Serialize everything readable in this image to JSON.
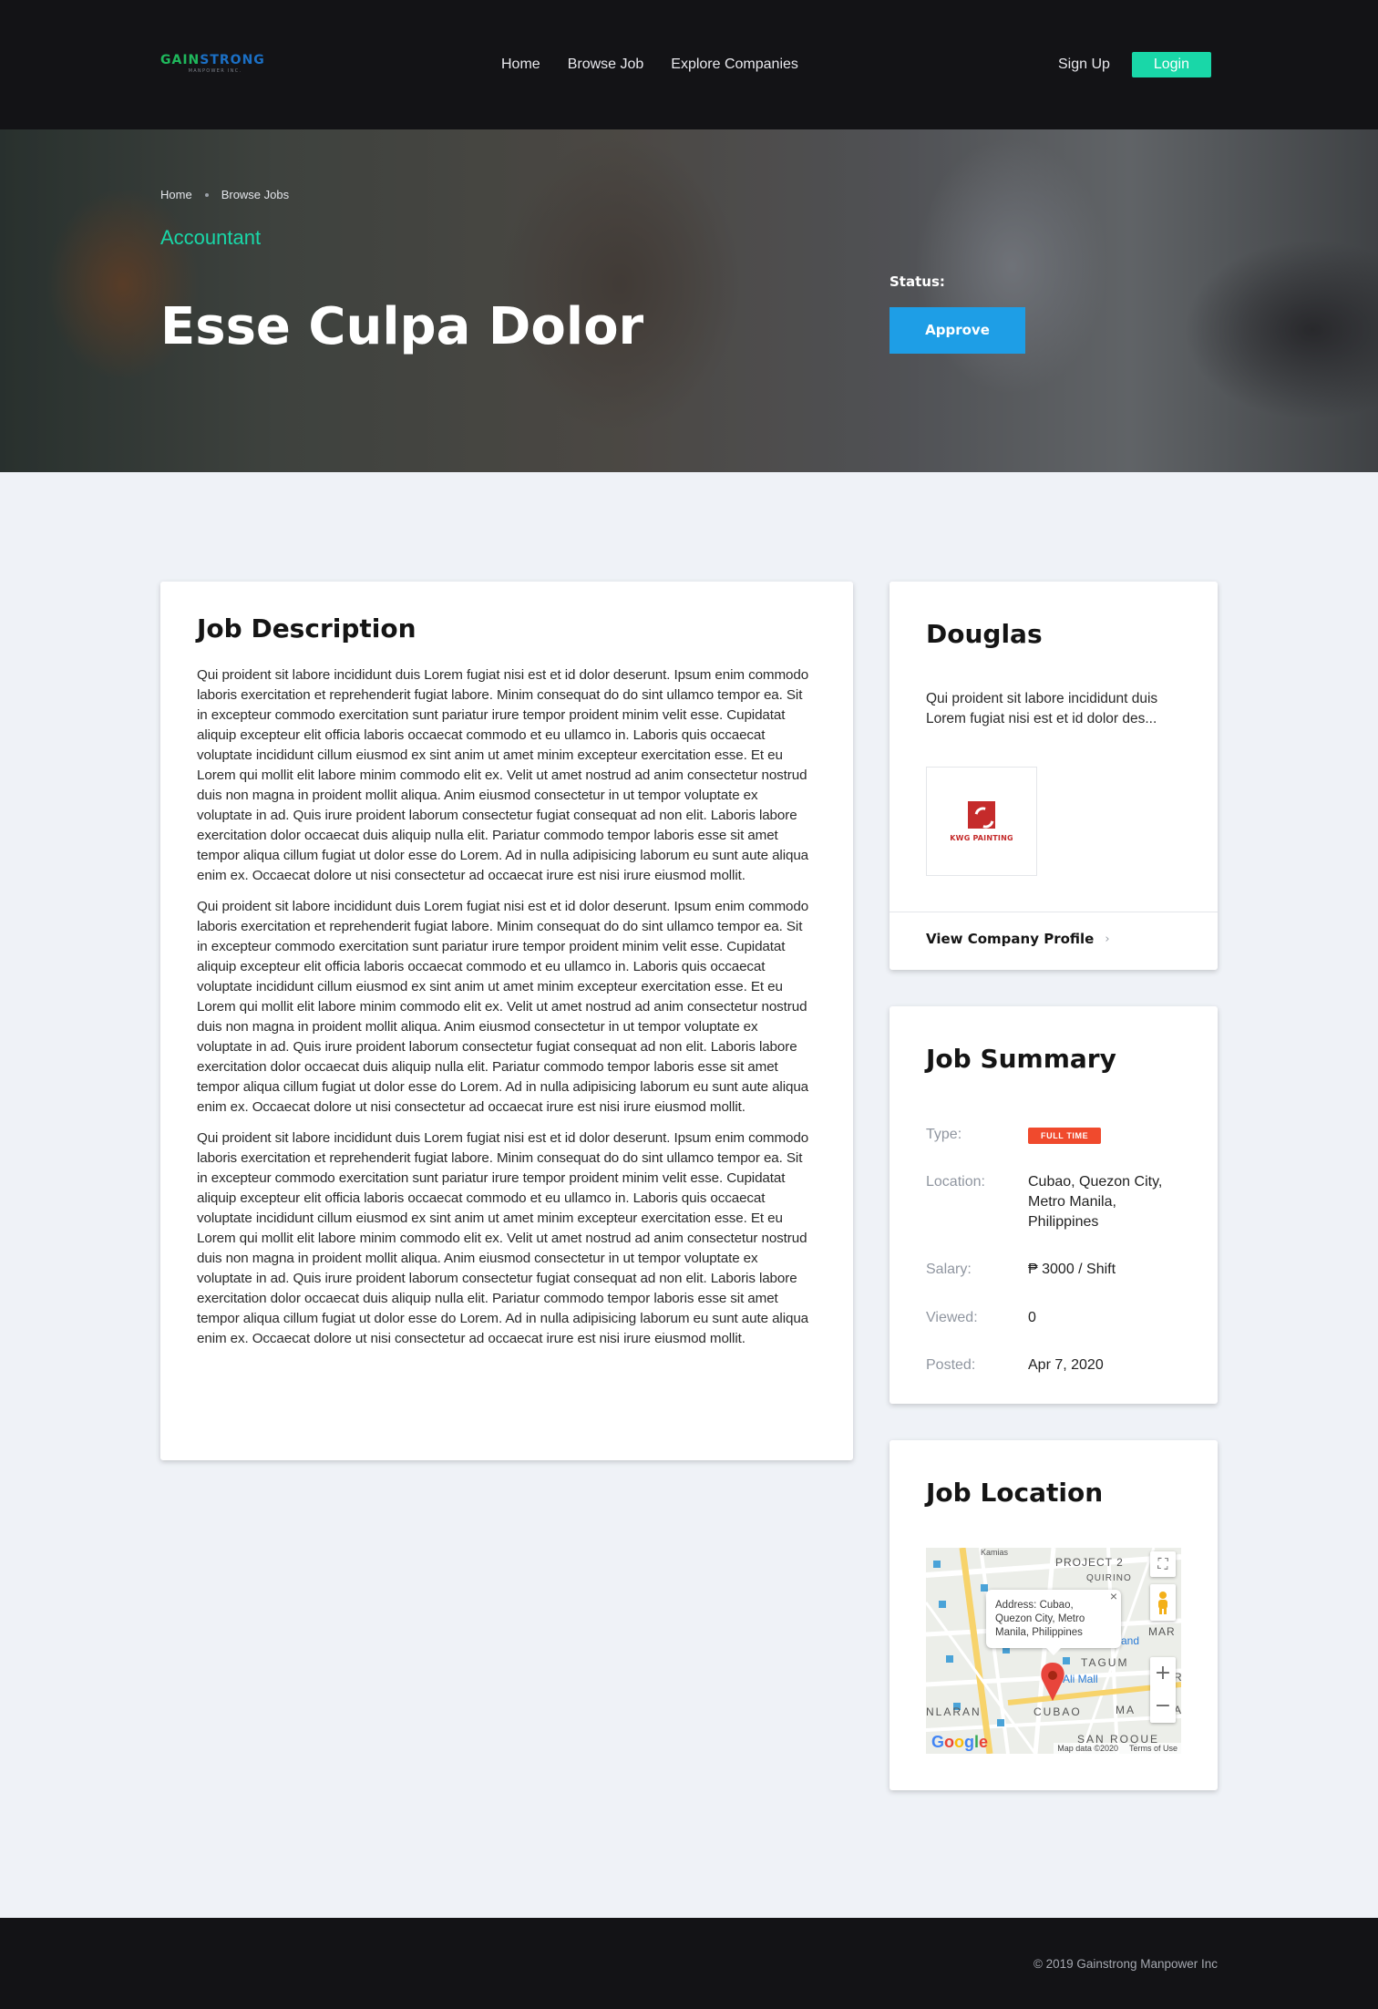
{
  "brand": {
    "word_a": "GAIN",
    "word_b": "STRONG",
    "tagline": "MANPOWER INC."
  },
  "nav": [
    "Home",
    "Browse Job",
    "Explore Companies"
  ],
  "auth": {
    "signup": "Sign Up",
    "login": "Login"
  },
  "breadcrumb": [
    "Home",
    "Browse Jobs"
  ],
  "job": {
    "category": "Accountant",
    "title": "Esse Culpa Dolor",
    "status_label": "Status:",
    "status_button": "Approve"
  },
  "description": {
    "heading": "Job Description",
    "paragraphs": [
      "Qui proident sit labore incididunt duis Lorem fugiat nisi est et id dolor deserunt. Ipsum enim commodo laboris exercitation et reprehenderit fugiat labore. Minim consequat do do sint ullamco tempor ea. Sit in excepteur commodo exercitation sunt pariatur irure tempor proident minim velit esse. Cupidatat aliquip excepteur elit officia laboris occaecat commodo et eu ullamco in. Laboris quis occaecat voluptate incididunt cillum eiusmod ex sint anim ut amet minim excepteur exercitation esse. Et eu Lorem qui mollit elit labore minim commodo elit ex. Velit ut amet nostrud ad anim consectetur nostrud duis non magna in proident mollit aliqua. Anim eiusmod consectetur in ut tempor voluptate ex voluptate in ad. Quis irure proident laborum consectetur fugiat consequat ad non elit. Laboris labore exercitation dolor occaecat duis aliquip nulla elit. Pariatur commodo tempor laboris esse sit amet tempor aliqua cillum fugiat ut dolor esse do Lorem. Ad in nulla adipisicing laborum eu sunt aute aliqua enim ex. Occaecat dolore ut nisi consectetur ad occaecat irure est nisi irure eiusmod mollit.",
      "Qui proident sit labore incididunt duis Lorem fugiat nisi est et id dolor deserunt. Ipsum enim commodo laboris exercitation et reprehenderit fugiat labore. Minim consequat do do sint ullamco tempor ea. Sit in excepteur commodo exercitation sunt pariatur irure tempor proident minim velit esse. Cupidatat aliquip excepteur elit officia laboris occaecat commodo et eu ullamco in. Laboris quis occaecat voluptate incididunt cillum eiusmod ex sint anim ut amet minim excepteur exercitation esse. Et eu Lorem qui mollit elit labore minim commodo elit ex. Velit ut amet nostrud ad anim consectetur nostrud duis non magna in proident mollit aliqua. Anim eiusmod consectetur in ut tempor voluptate ex voluptate in ad. Quis irure proident laborum consectetur fugiat consequat ad non elit. Laboris labore exercitation dolor occaecat duis aliquip nulla elit. Pariatur commodo tempor laboris esse sit amet tempor aliqua cillum fugiat ut dolor esse do Lorem. Ad in nulla adipisicing laborum eu sunt aute aliqua enim ex. Occaecat dolore ut nisi consectetur ad occaecat irure est nisi irure eiusmod mollit.",
      "Qui proident sit labore incididunt duis Lorem fugiat nisi est et id dolor deserunt. Ipsum enim commodo laboris exercitation et reprehenderit fugiat labore. Minim consequat do do sint ullamco tempor ea. Sit in excepteur commodo exercitation sunt pariatur irure tempor proident minim velit esse. Cupidatat aliquip excepteur elit officia laboris occaecat commodo et eu ullamco in. Laboris quis occaecat voluptate incididunt cillum eiusmod ex sint anim ut amet minim excepteur exercitation esse. Et eu Lorem qui mollit elit labore minim commodo elit ex. Velit ut amet nostrud ad anim consectetur nostrud duis non magna in proident mollit aliqua. Anim eiusmod consectetur in ut tempor voluptate ex voluptate in ad. Quis irure proident laborum consectetur fugiat consequat ad non elit. Laboris labore exercitation dolor occaecat duis aliquip nulla elit. Pariatur commodo tempor laboris esse sit amet tempor aliqua cillum fugiat ut dolor esse do Lorem. Ad in nulla adipisicing laborum eu sunt aute aliqua enim ex. Occaecat dolore ut nisi consectetur ad occaecat irure est nisi irure eiusmod mollit."
    ]
  },
  "company": {
    "name": "Douglas",
    "blurb": "Qui proident sit labore incididunt duis Lorem fugiat nisi est et id dolor des...",
    "logo_text": "KWG PAINTING",
    "profile_link": "View Company Profile",
    "chevron": "›"
  },
  "summary": {
    "heading": "Job Summary",
    "type_label": "Type:",
    "type_value": "FULL TIME",
    "location_label": "Location:",
    "location_value": "Cubao, Quezon City, Metro Manila, Philippines",
    "salary_label": "Salary:",
    "salary_value": "₱ 3000 / Shift",
    "viewed_label": "Viewed:",
    "viewed_value": "0",
    "posted_label": "Posted:",
    "posted_value": "Apr 7, 2020"
  },
  "map": {
    "heading": "Job Location",
    "info": "Address: Cubao, Quezon City, Metro Manila, Philippines",
    "close": "×",
    "labels": [
      "Kamias",
      "PROJECT 2",
      "QUIRINO",
      "TAGUM",
      "Ali Mall",
      "NLARAN",
      "CUBAO",
      "MA",
      "SAN ROQUE",
      "and",
      "MAR",
      "R",
      "A"
    ],
    "zoom_in": "+",
    "zoom_out": "−",
    "google": [
      "G",
      "o",
      "o",
      "g",
      "l",
      "e"
    ],
    "map_data": "Map data ©2020",
    "terms": "Terms of Use"
  },
  "footer": {
    "copyright": "© 2019 Gainstrong Manpower Inc"
  },
  "colors": {
    "accent": "#19d7a8",
    "button_blue": "#1e9ee6",
    "badge": "#f04a2d",
    "dark": "#131316",
    "page_bg": "#eff2f7"
  }
}
